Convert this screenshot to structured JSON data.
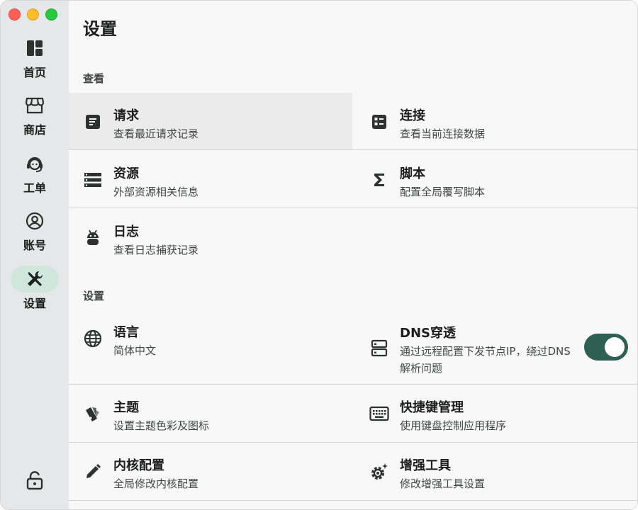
{
  "sidebar": {
    "items": [
      {
        "label": "首页",
        "icon": "dashboard-icon"
      },
      {
        "label": "商店",
        "icon": "store-icon"
      },
      {
        "label": "工单",
        "icon": "support-agent-icon"
      },
      {
        "label": "账号",
        "icon": "account-circle-icon"
      },
      {
        "label": "设置",
        "icon": "tools-icon",
        "active": true
      }
    ],
    "bottom_icon": "lock-icon"
  },
  "main": {
    "title": "设置",
    "sections": [
      {
        "title": "查看",
        "items": [
          {
            "title": "请求",
            "subtitle": "查看最近请求记录",
            "icon": "request-icon"
          },
          {
            "title": "连接",
            "subtitle": "查看当前连接数据",
            "icon": "connection-icon"
          },
          {
            "title": "资源",
            "subtitle": "外部资源相关信息",
            "icon": "resource-icon"
          },
          {
            "title": "脚本",
            "subtitle": "配置全局覆写脚本",
            "icon": "sigma-icon"
          },
          {
            "title": "日志",
            "subtitle": "查看日志捕获记录",
            "icon": "android-icon"
          }
        ]
      },
      {
        "title": "设置",
        "items": [
          {
            "title": "语言",
            "subtitle": "简体中文",
            "icon": "globe-icon"
          },
          {
            "title": "DNS穿透",
            "subtitle": "通过远程配置下发节点IP，绕过DNS解析问题",
            "icon": "dns-icon",
            "toggle": true
          },
          {
            "title": "主题",
            "subtitle": "设置主题色彩及图标",
            "icon": "palette-icon"
          },
          {
            "title": "快捷键管理",
            "subtitle": "使用键盘控制应用程序",
            "icon": "keyboard-icon"
          },
          {
            "title": "内核配置",
            "subtitle": "全局修改内核配置",
            "icon": "pencil-icon"
          },
          {
            "title": "增强工具",
            "subtitle": "修改增强工具设置",
            "icon": "gear-sparkle-icon"
          }
        ]
      }
    ]
  },
  "colors": {
    "accent": "#2f5e52",
    "active_nav_bg": "#cfe6dd",
    "sidebar_bg": "#e6e7e8",
    "content_bg": "#f7f8f7"
  }
}
